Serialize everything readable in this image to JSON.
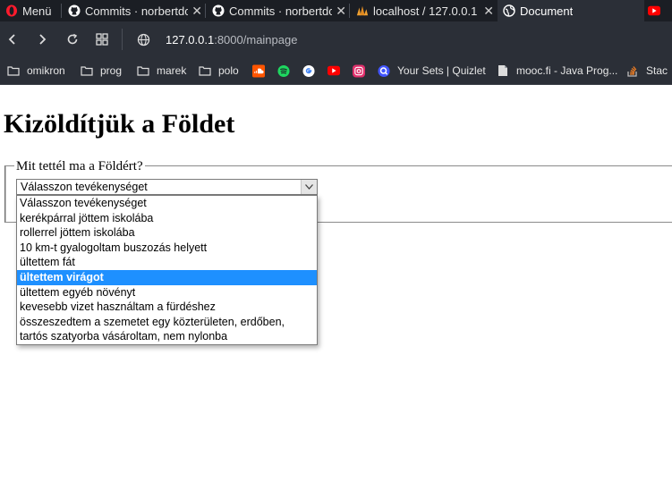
{
  "browser": {
    "menu_label": "Menü",
    "tabs": [
      {
        "title": "Commits · norbertdc",
        "icon": "github-icon"
      },
      {
        "title": "Commits · norbertdc",
        "icon": "github-icon"
      },
      {
        "title": "localhost / 127.0.0.1",
        "icon": "phpmyadmin-icon"
      },
      {
        "title": "Document",
        "icon": "globe-icon",
        "active": true
      }
    ],
    "address": {
      "host": "127.0.0.1",
      "path": ":8000/mainpage"
    },
    "bookmarks": [
      {
        "label": "omikron",
        "icon": "folder-icon"
      },
      {
        "label": "prog",
        "icon": "folder-icon"
      },
      {
        "label": "marek",
        "icon": "folder-icon"
      },
      {
        "label": "polo",
        "icon": "folder-icon"
      },
      {
        "label": "",
        "icon": "soundcloud-icon"
      },
      {
        "label": "",
        "icon": "spotify-icon"
      },
      {
        "label": "",
        "icon": "google-icon"
      },
      {
        "label": "",
        "icon": "youtube-icon"
      },
      {
        "label": "",
        "icon": "instagram-icon"
      },
      {
        "label": "Your Sets | Quizlet",
        "icon": "quizlet-icon"
      },
      {
        "label": "mooc.fi - Java Prog...",
        "icon": "file-icon"
      },
      {
        "label": "Stac",
        "icon": "stackoverflow-icon"
      }
    ]
  },
  "page": {
    "heading": "Kizöldítjük a Földet",
    "legend": "Mit tettél ma a Földért?",
    "select": {
      "value": "Válasszon tevékenységet",
      "options": [
        "Válasszon tevékenységet",
        "kerékpárral jöttem iskolába",
        "rollerrel jöttem iskolába",
        "10 km-t gyalogoltam buszozás helyett",
        "ültettem fát",
        "ültettem virágot",
        "ültettem egyéb növényt",
        "kevesebb vizet használtam a fürdéshez",
        "összeszedtem a szemetet egy közterületen, erdőben,",
        "tartós szatyorba vásároltam, nem nylonba"
      ],
      "highlighted_index": 5
    }
  },
  "colors": {
    "highlight": "#1e90ff",
    "chrome_dark": "#1b1e24",
    "chrome": "#2b2f37"
  }
}
